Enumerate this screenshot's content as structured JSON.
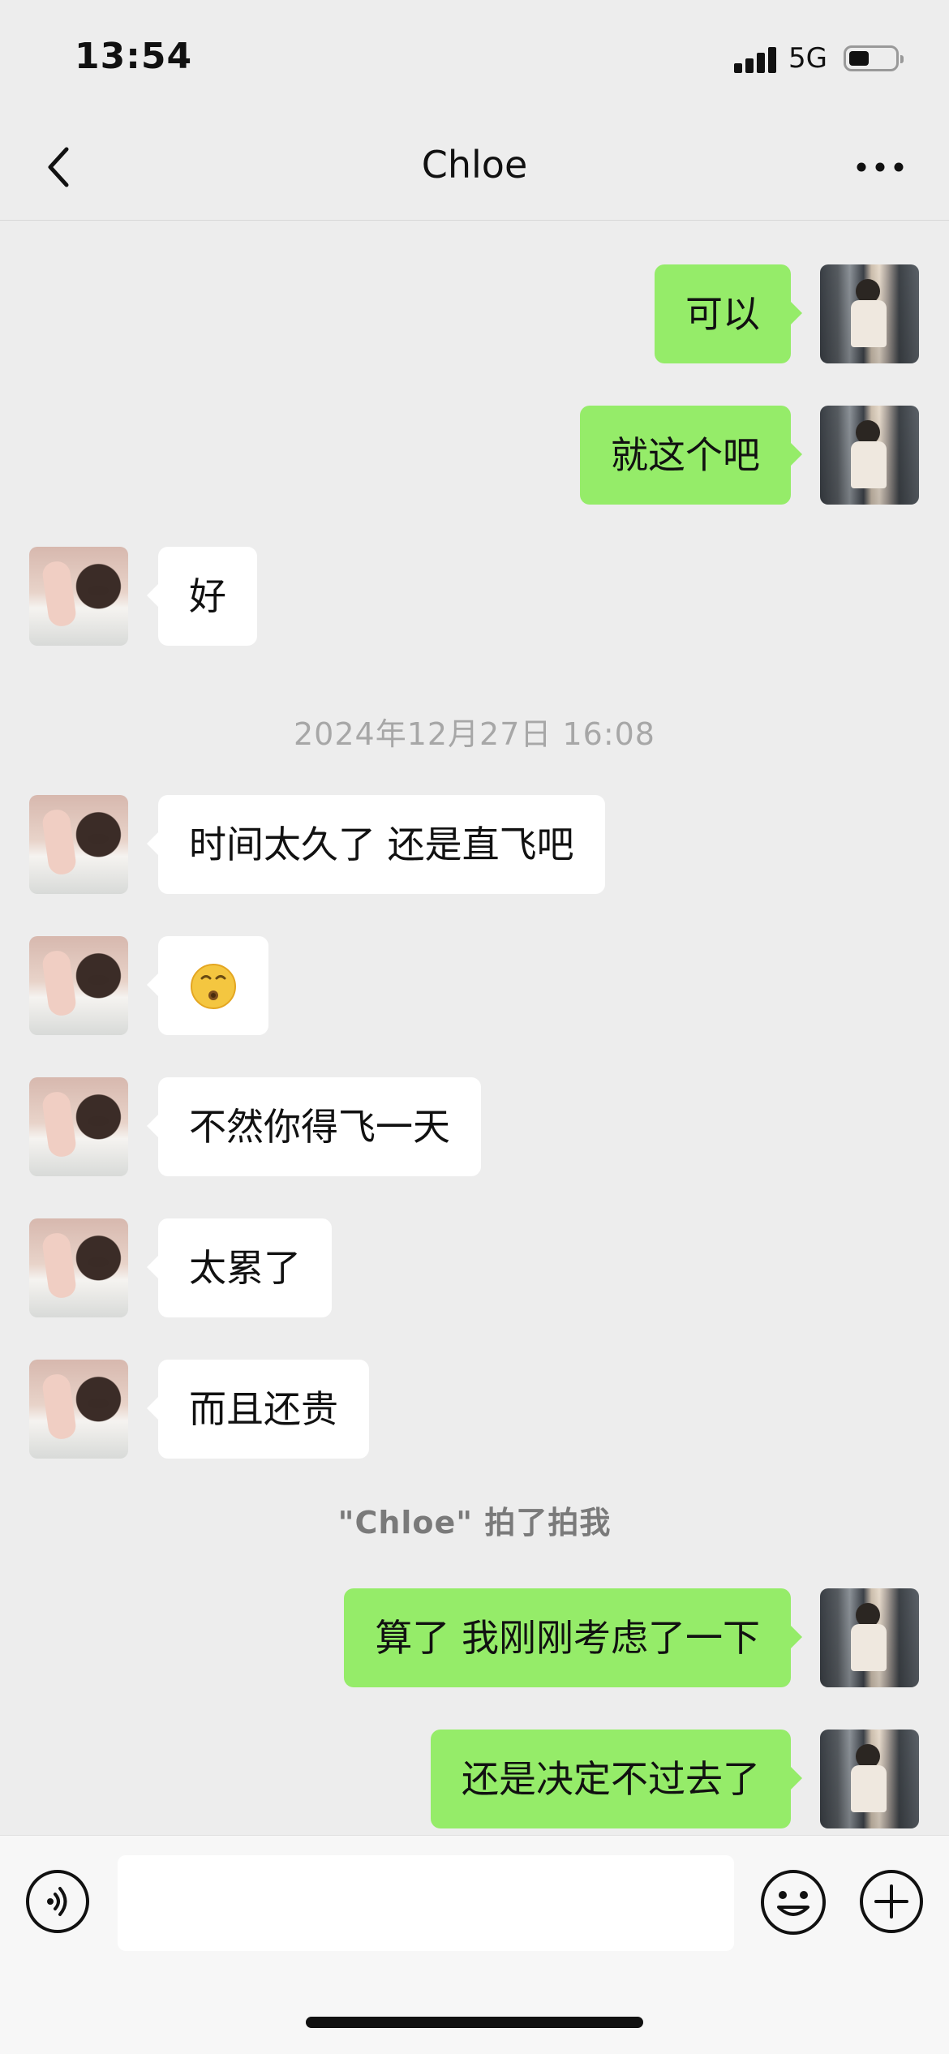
{
  "status_bar": {
    "time": "13:54",
    "network": "5G",
    "battery_level": 0.45
  },
  "nav": {
    "title": "Chloe",
    "back_icon": "chevron-left-icon",
    "more_icon": "ellipsis-icon"
  },
  "messages": [
    {
      "from": "me",
      "text": "可以"
    },
    {
      "from": "me",
      "text": "就这个吧"
    },
    {
      "from": "them",
      "text": "好"
    },
    {
      "type": "timestamp",
      "text": "2024年12月27日 16:08"
    },
    {
      "from": "them",
      "text": "时间太久了 还是直飞吧"
    },
    {
      "from": "them",
      "emoji": "kissing-face-emoji"
    },
    {
      "from": "them",
      "text": "不然你得飞一天"
    },
    {
      "from": "them",
      "text": "太累了"
    },
    {
      "from": "them",
      "text": "而且还贵"
    },
    {
      "type": "system",
      "text": "\"Chloe\" 拍了拍我"
    },
    {
      "from": "me",
      "text": "算了 我刚刚考虑了一下"
    },
    {
      "from": "me",
      "text": "还是决定不过去了"
    }
  ],
  "input_bar": {
    "value": "",
    "voice_icon": "voice-icon",
    "emoji_icon": "emoji-icon",
    "plus_icon": "plus-icon"
  },
  "colors": {
    "background": "#ededed",
    "my_bubble": "#95ec69",
    "their_bubble": "#ffffff"
  }
}
